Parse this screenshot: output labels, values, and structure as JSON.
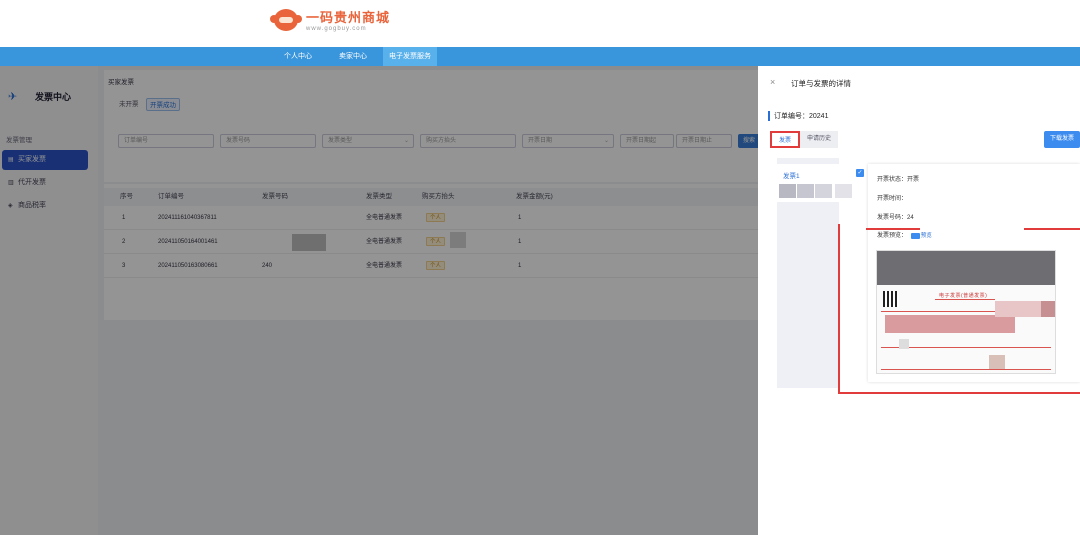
{
  "brand": {
    "title": "一码贵州商城",
    "subtitle": "www.gogbuy.com"
  },
  "nav": {
    "items": [
      "个人中心",
      "卖家中心",
      "电子发票服务"
    ],
    "active_index": 2
  },
  "sidebar": {
    "title": "发票中心",
    "group": "发票管理",
    "items": [
      {
        "label": "买家发票",
        "icon": "file-icon",
        "active": true
      },
      {
        "label": "代开发票",
        "icon": "file-edit-icon",
        "active": false
      },
      {
        "label": "商品税率",
        "icon": "tag-icon",
        "active": false
      }
    ]
  },
  "main": {
    "breadcrumb": "买家发票",
    "subtabs": [
      "未开票",
      "开票成功"
    ],
    "filters": [
      "订单编号",
      "发票号码",
      "发票类型",
      "购买方抬头",
      "开票日期",
      "开票日期起",
      "开票日期止"
    ],
    "search_label": "搜索",
    "table": {
      "columns": [
        "序号",
        "订单编号",
        "发票号码",
        "发票类型",
        "购买方抬头",
        "发票金额(元)"
      ],
      "rows": [
        {
          "index": "1",
          "order": "202411161040367811",
          "invoice_type": "全电普通发票",
          "buyer_tag": "个人",
          "amount": "1"
        },
        {
          "index": "2",
          "order": "202411050164001461",
          "invoice_type": "全电普通发票",
          "buyer_tag": "个人",
          "amount": "1"
        },
        {
          "index": "3",
          "order": "202411050163080661",
          "invoice_no": "240",
          "invoice_type": "全电普通发票",
          "buyer_tag": "个人",
          "amount": "1"
        }
      ]
    }
  },
  "drawer": {
    "title": "订单与发票的详情",
    "order_label": "订单编号：20241",
    "tabs": [
      "发票",
      "申请历史"
    ],
    "download_label": "下载发票",
    "invoice_item_label": "发票1",
    "detail": {
      "status": "开票状态：开票",
      "time": "开票时间：",
      "number": "发票号码：24",
      "preview_label": "发票预览：",
      "preview_link": "预览"
    },
    "thumbnail_title": "电子发票(普通发票)"
  },
  "colors": {
    "nav_blue": "#3a96dc",
    "sidebar_active": "#2c55c8",
    "accent": "#2a6fd6",
    "highlight_red": "#e23b3b"
  }
}
